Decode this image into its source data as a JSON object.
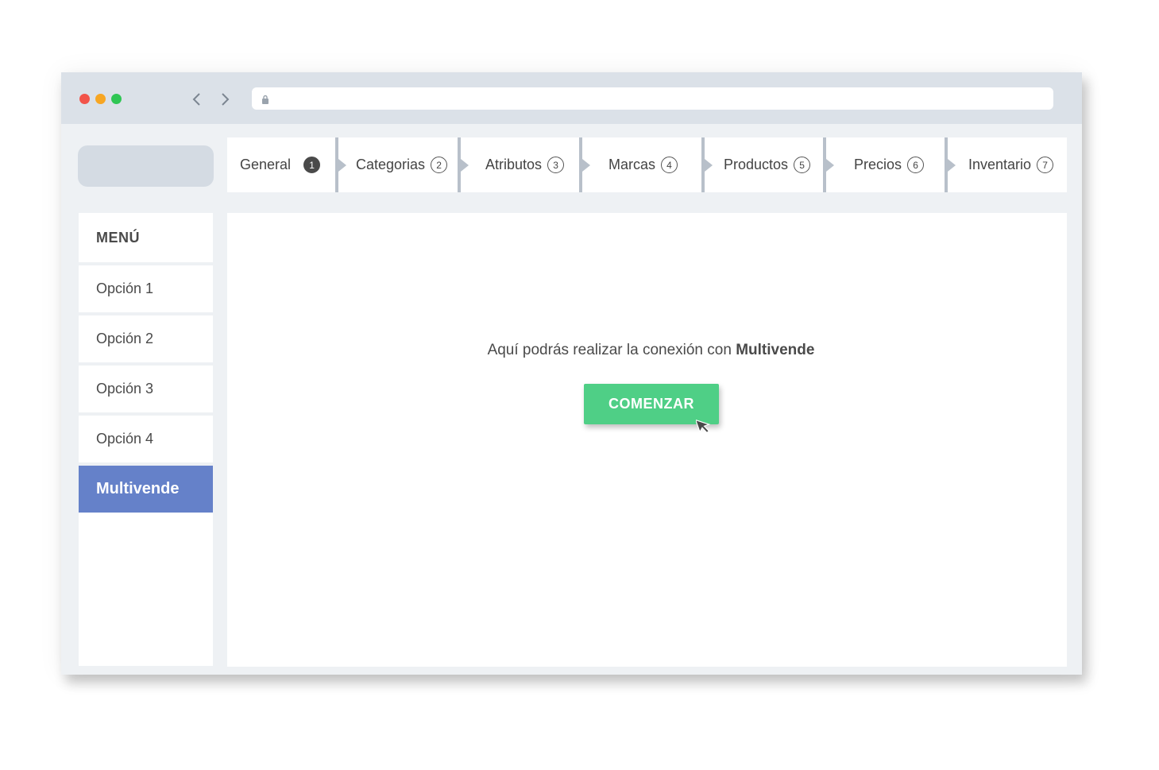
{
  "browser": {
    "url": "",
    "icons": {
      "back": "chevron-left-icon",
      "forward": "chevron-right-icon",
      "lock": "lock-icon"
    }
  },
  "steps": [
    {
      "label": "General",
      "number": "1",
      "active": true
    },
    {
      "label": "Categorias",
      "number": "2",
      "active": false
    },
    {
      "label": "Atributos",
      "number": "3",
      "active": false
    },
    {
      "label": "Marcas",
      "number": "4",
      "active": false
    },
    {
      "label": "Productos",
      "number": "5",
      "active": false
    },
    {
      "label": "Precios",
      "number": "6",
      "active": false
    },
    {
      "label": "Inventario",
      "number": "7",
      "active": false
    }
  ],
  "sidebar": {
    "title": "MENÚ",
    "items": [
      {
        "label": "Opción 1"
      },
      {
        "label": "Opción 2"
      },
      {
        "label": "Opción 3"
      },
      {
        "label": "Opción 4"
      },
      {
        "label": "Multivende",
        "active": true
      }
    ]
  },
  "main": {
    "message_prefix": "Aquí podrás realizar la conexión con",
    "message_brand": "Multivende",
    "cta_label": "COMENZAR"
  },
  "colors": {
    "accent_blue": "#6581c9",
    "cta_green": "#4fcf86",
    "window_bg": "#eef1f4",
    "titlebar": "#dbe1e8"
  }
}
